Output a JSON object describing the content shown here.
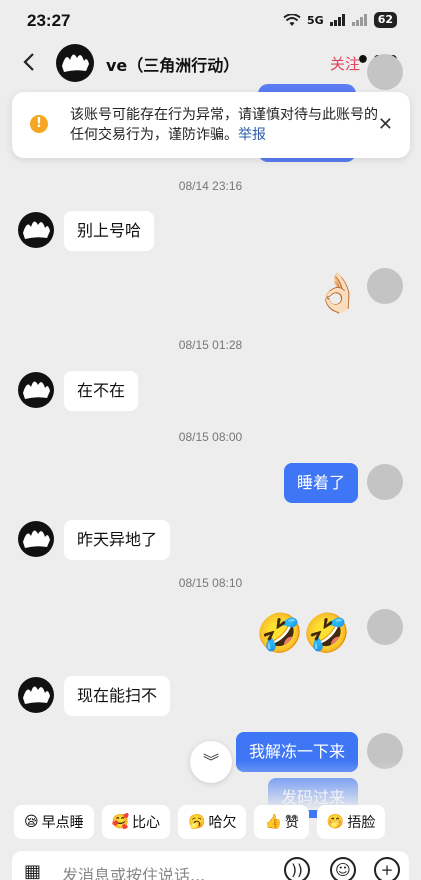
{
  "status_bar": {
    "time": "23:27",
    "network": "5G",
    "battery": "62"
  },
  "header": {
    "title": "ve（三角洲行动）",
    "follow_label": "关注"
  },
  "warning": {
    "text": "该账号可能存在行为异常，请谨慎对待与此账号的任何交易行为，谨防诈骗。",
    "report_label": "举报"
  },
  "messages": [
    {
      "type": "time",
      "text": "08/14 23:16"
    },
    {
      "type": "in",
      "text": "别上号哈"
    },
    {
      "type": "out-emoji",
      "emoji": "👌🏻"
    },
    {
      "type": "time",
      "text": "08/15 01:28"
    },
    {
      "type": "in",
      "text": "在不在"
    },
    {
      "type": "time",
      "text": "08/15 08:00"
    },
    {
      "type": "out",
      "text": "睡着了"
    },
    {
      "type": "in",
      "text": "昨天异地了"
    },
    {
      "type": "time",
      "text": "08/15 08:10"
    },
    {
      "type": "out-emoji",
      "emoji": "🤣🤣"
    },
    {
      "type": "in",
      "text": "现在能扫不"
    },
    {
      "type": "out",
      "text": "我解冻一下来"
    },
    {
      "type": "out",
      "text": "发码过来"
    }
  ],
  "quick_replies": [
    {
      "emoji": "😪",
      "label": "早点睡"
    },
    {
      "emoji": "🥰",
      "label": "比心"
    },
    {
      "emoji": "🥱",
      "label": "哈欠"
    },
    {
      "emoji": "👍",
      "label": "赞"
    },
    {
      "emoji": "🤭",
      "label": "捂脸"
    }
  ],
  "input": {
    "placeholder": "发消息或按住说话..."
  },
  "colors": {
    "accent_blue": "#3e76f5",
    "follow_red": "#e0445a",
    "warning_orange": "#f5a623"
  }
}
